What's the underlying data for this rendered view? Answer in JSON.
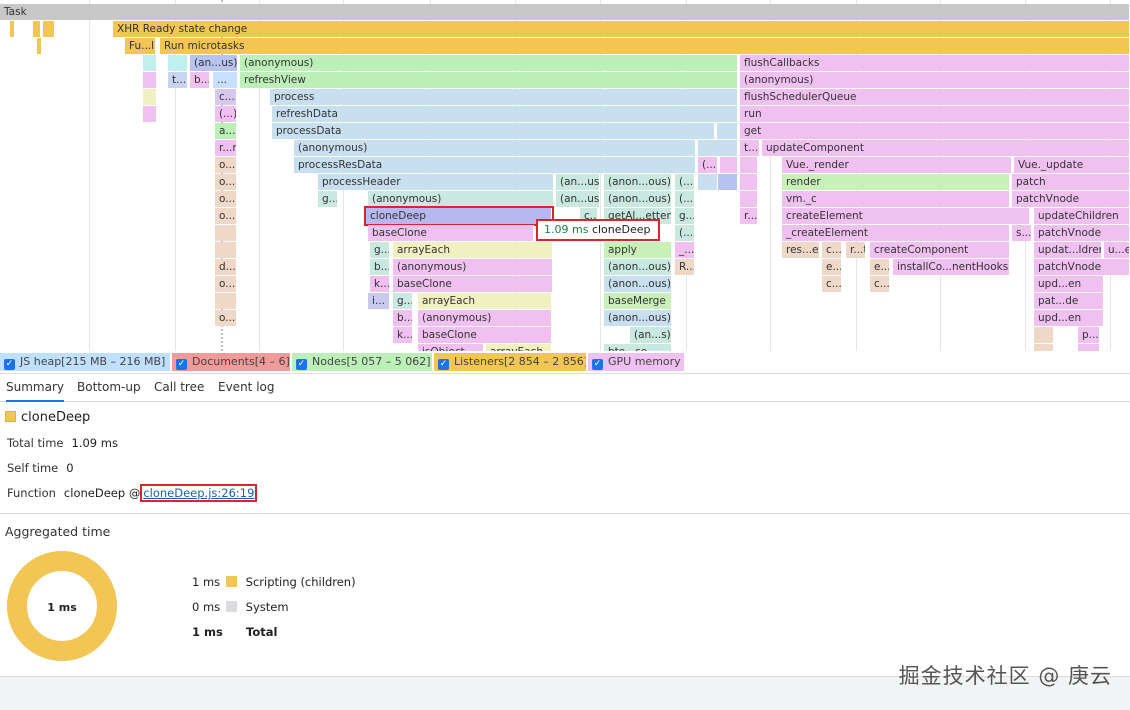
{
  "flame": {
    "vlines": [
      89,
      175,
      259,
      343,
      430,
      515,
      600,
      686,
      770,
      856,
      940,
      1025,
      1110
    ],
    "blocks": [
      {
        "l": 0,
        "t": 4,
        "w": 1130,
        "c": "#c8c8c8",
        "s": "Task"
      },
      {
        "l": 10,
        "t": 21,
        "w": 3,
        "c": "#f1c654",
        "s": ""
      },
      {
        "l": 33,
        "t": 21,
        "w": 8,
        "c": "#f1c654",
        "s": ""
      },
      {
        "l": 43,
        "t": 21,
        "w": 12,
        "c": "#f1c654",
        "s": ""
      },
      {
        "l": 113,
        "t": 21,
        "w": 1017,
        "c": "#f1c654",
        "s": "XHR Ready state change"
      },
      {
        "l": 37,
        "t": 38,
        "w": 4,
        "c": "#f1c654",
        "s": ""
      },
      {
        "l": 125,
        "t": 38,
        "w": 31,
        "c": "#f1c654",
        "s": "Fu...l"
      },
      {
        "l": 160,
        "t": 38,
        "w": 970,
        "c": "#f1c654",
        "s": "Run microtasks"
      },
      {
        "l": 143,
        "t": 55,
        "w": 14,
        "c": "#bff0ee",
        "s": ""
      },
      {
        "l": 168,
        "t": 55,
        "w": 20,
        "c": "#bff0ee",
        "s": ""
      },
      {
        "l": 190,
        "t": 55,
        "w": 48,
        "c": "#b8c4f0",
        "s": "(an...us)"
      },
      {
        "l": 240,
        "t": 55,
        "w": 498,
        "c": "#bdf0b8",
        "s": "(anonymous)"
      },
      {
        "l": 740,
        "t": 55,
        "w": 390,
        "c": "#f0c0f0",
        "s": "flushCallbacks"
      },
      {
        "l": 143,
        "t": 72,
        "w": 14,
        "c": "#f0c0f0",
        "s": ""
      },
      {
        "l": 168,
        "t": 72,
        "w": 20,
        "c": "#c8d4f0",
        "s": "t..."
      },
      {
        "l": 190,
        "t": 72,
        "w": 20,
        "c": "#f0c0f0",
        "s": "b..."
      },
      {
        "l": 213,
        "t": 72,
        "w": 25,
        "c": "#c8e0ff",
        "s": "..."
      },
      {
        "l": 240,
        "t": 72,
        "w": 498,
        "c": "#bdf0b8",
        "s": "refreshView"
      },
      {
        "l": 740,
        "t": 72,
        "w": 390,
        "c": "#f0c0f0",
        "s": "(anonymous)"
      },
      {
        "l": 143,
        "t": 89,
        "w": 14,
        "c": "#f0f0c0",
        "s": ""
      },
      {
        "l": 215,
        "t": 89,
        "w": 22,
        "c": "#d8c8f0",
        "s": "c..."
      },
      {
        "l": 270,
        "t": 89,
        "w": 468,
        "c": "#c8dff0",
        "s": "process"
      },
      {
        "l": 740,
        "t": 89,
        "w": 390,
        "c": "#f0c0f0",
        "s": "flushSchedulerQueue"
      },
      {
        "l": 143,
        "t": 106,
        "w": 14,
        "c": "#f0c0f0",
        "s": ""
      },
      {
        "l": 215,
        "t": 106,
        "w": 22,
        "c": "#f0c0f0",
        "s": "(...)"
      },
      {
        "l": 272,
        "t": 106,
        "w": 466,
        "c": "#c8dff0",
        "s": "refreshData"
      },
      {
        "l": 740,
        "t": 106,
        "w": 390,
        "c": "#f0c0f0",
        "s": "run"
      },
      {
        "l": 215,
        "t": 123,
        "w": 22,
        "c": "#bdf0b8",
        "s": "a..."
      },
      {
        "l": 272,
        "t": 123,
        "w": 443,
        "c": "#c8dff0",
        "s": "processData"
      },
      {
        "l": 717,
        "t": 123,
        "w": 21,
        "c": "#c8dff0",
        "s": ""
      },
      {
        "l": 740,
        "t": 123,
        "w": 390,
        "c": "#f0c0f0",
        "s": "get"
      },
      {
        "l": 215,
        "t": 140,
        "w": 22,
        "c": "#f0c0f0",
        "s": "r...r"
      },
      {
        "l": 294,
        "t": 140,
        "w": 402,
        "c": "#c8dff0",
        "s": "(anonymous)"
      },
      {
        "l": 698,
        "t": 140,
        "w": 40,
        "c": "#c8dff0",
        "s": ""
      },
      {
        "l": 740,
        "t": 140,
        "w": 20,
        "c": "#f0c0f0",
        "s": "t..."
      },
      {
        "l": 762,
        "t": 140,
        "w": 368,
        "c": "#f0c0f0",
        "s": "updateComponent"
      },
      {
        "l": 215,
        "t": 157,
        "w": 22,
        "c": "#f0d8c8",
        "s": "o..."
      },
      {
        "l": 294,
        "t": 157,
        "w": 402,
        "c": "#c8dff0",
        "s": "processResData"
      },
      {
        "l": 698,
        "t": 157,
        "w": 20,
        "c": "#f0c0f0",
        "s": "(..."
      },
      {
        "l": 720,
        "t": 157,
        "w": 18,
        "c": "#f0c0f0",
        "s": ""
      },
      {
        "l": 740,
        "t": 157,
        "w": 18,
        "c": "#f0c0f0",
        "s": ""
      },
      {
        "l": 782,
        "t": 157,
        "w": 230,
        "c": "#f0c0f0",
        "s": "Vue._render"
      },
      {
        "l": 1014,
        "t": 157,
        "w": 116,
        "c": "#f0c0f0",
        "s": "Vue._update"
      },
      {
        "l": 215,
        "t": 174,
        "w": 22,
        "c": "#f0d8c8",
        "s": "o..."
      },
      {
        "l": 318,
        "t": 174,
        "w": 236,
        "c": "#c8dff0",
        "s": "processHeader"
      },
      {
        "l": 556,
        "t": 174,
        "w": 44,
        "c": "#c8e8e0",
        "s": "(an...us)"
      },
      {
        "l": 604,
        "t": 174,
        "w": 68,
        "c": "#c8e8e0",
        "s": "(anon...ous)"
      },
      {
        "l": 675,
        "t": 174,
        "w": 20,
        "c": "#c8e8e0",
        "s": "(...)"
      },
      {
        "l": 698,
        "t": 174,
        "w": 20,
        "c": "#c8dff0",
        "s": ""
      },
      {
        "l": 718,
        "t": 174,
        "w": 20,
        "c": "#b8c4f0",
        "s": ""
      },
      {
        "l": 740,
        "t": 174,
        "w": 18,
        "c": "#f0c0f0",
        "s": ""
      },
      {
        "l": 782,
        "t": 174,
        "w": 228,
        "c": "#c8f0b8",
        "s": "render"
      },
      {
        "l": 1012,
        "t": 174,
        "w": 118,
        "c": "#f0c0f0",
        "s": "patch"
      },
      {
        "l": 215,
        "t": 191,
        "w": 22,
        "c": "#f0d8c8",
        "s": "o..."
      },
      {
        "l": 318,
        "t": 191,
        "w": 20,
        "c": "#c8e8e0",
        "s": "g..."
      },
      {
        "l": 368,
        "t": 191,
        "w": 186,
        "c": "#c8e8e0",
        "s": "(anonymous)"
      },
      {
        "l": 556,
        "t": 191,
        "w": 44,
        "c": "#c8e8e0",
        "s": "(an...us)"
      },
      {
        "l": 604,
        "t": 191,
        "w": 68,
        "c": "#c8e8e0",
        "s": "(anon...ous)"
      },
      {
        "l": 675,
        "t": 191,
        "w": 20,
        "c": "#c8e8e0",
        "s": "(...)"
      },
      {
        "l": 740,
        "t": 191,
        "w": 18,
        "c": "#f0c0f0",
        "s": ""
      },
      {
        "l": 782,
        "t": 191,
        "w": 228,
        "c": "#f0c0f0",
        "s": "vm._c"
      },
      {
        "l": 1012,
        "t": 191,
        "w": 118,
        "c": "#f0c0f0",
        "s": "patchVnode"
      },
      {
        "l": 215,
        "t": 208,
        "w": 22,
        "c": "#f0d8c8",
        "s": "o..."
      },
      {
        "l": 366,
        "t": 208,
        "w": 186,
        "c": "#b8b8f0",
        "s": "cloneDeep",
        "sel": true
      },
      {
        "l": 580,
        "t": 208,
        "w": 18,
        "c": "#c8e8e0",
        "s": "c..."
      },
      {
        "l": 604,
        "t": 208,
        "w": 68,
        "c": "#c8e8e0",
        "s": "getAl...etter"
      },
      {
        "l": 675,
        "t": 208,
        "w": 20,
        "c": "#c8e8e0",
        "s": "g..."
      },
      {
        "l": 740,
        "t": 208,
        "w": 18,
        "c": "#f0c0f0",
        "s": "r..."
      },
      {
        "l": 782,
        "t": 208,
        "w": 248,
        "c": "#f0c0f0",
        "s": "createElement"
      },
      {
        "l": 1034,
        "t": 208,
        "w": 96,
        "c": "#f0c0f0",
        "s": "updateChildren"
      },
      {
        "l": 215,
        "t": 225,
        "w": 22,
        "c": "#f0d8c8",
        "s": ""
      },
      {
        "l": 368,
        "t": 225,
        "w": 166,
        "c": "#f0c0f0",
        "s": "baseClone"
      },
      {
        "l": 675,
        "t": 225,
        "w": 20,
        "c": "#c8e8e0",
        "s": "(...)"
      },
      {
        "l": 782,
        "t": 225,
        "w": 228,
        "c": "#f0c0f0",
        "s": "_createElement"
      },
      {
        "l": 1012,
        "t": 225,
        "w": 20,
        "c": "#f0c0f0",
        "s": "s..."
      },
      {
        "l": 1034,
        "t": 225,
        "w": 96,
        "c": "#f0c0f0",
        "s": "patchVnode"
      },
      {
        "l": 215,
        "t": 242,
        "w": 22,
        "c": "#f0d8c8",
        "s": ""
      },
      {
        "l": 370,
        "t": 242,
        "w": 20,
        "c": "#c8e8e0",
        "s": "g..."
      },
      {
        "l": 393,
        "t": 242,
        "w": 160,
        "c": "#f0f0c0",
        "s": "arrayEach"
      },
      {
        "l": 604,
        "t": 242,
        "w": 68,
        "c": "#c8f0b8",
        "s": "apply"
      },
      {
        "l": 675,
        "t": 242,
        "w": 20,
        "c": "#f0c0f0",
        "s": "_..."
      },
      {
        "l": 782,
        "t": 242,
        "w": 38,
        "c": "#f0d8c8",
        "s": "res...et"
      },
      {
        "l": 822,
        "t": 242,
        "w": 20,
        "c": "#f0d8c8",
        "s": "c..."
      },
      {
        "l": 846,
        "t": 242,
        "w": 20,
        "c": "#f0d8c8",
        "s": "r...t"
      },
      {
        "l": 870,
        "t": 242,
        "w": 140,
        "c": "#f0c0f0",
        "s": "createComponent"
      },
      {
        "l": 1034,
        "t": 242,
        "w": 68,
        "c": "#f0c0f0",
        "s": "updat...ldren"
      },
      {
        "l": 1104,
        "t": 242,
        "w": 26,
        "c": "#f0c0f0",
        "s": "u...e"
      },
      {
        "l": 215,
        "t": 259,
        "w": 22,
        "c": "#f0d8c8",
        "s": "d..."
      },
      {
        "l": 370,
        "t": 259,
        "w": 20,
        "c": "#c8e8e0",
        "s": "b..."
      },
      {
        "l": 393,
        "t": 259,
        "w": 160,
        "c": "#f0c0f0",
        "s": "(anonymous)"
      },
      {
        "l": 604,
        "t": 259,
        "w": 68,
        "c": "#c8e8e0",
        "s": "(anon...ous)"
      },
      {
        "l": 675,
        "t": 259,
        "w": 20,
        "c": "#f0d8c8",
        "s": "R..."
      },
      {
        "l": 822,
        "t": 259,
        "w": 20,
        "c": "#f0d8c8",
        "s": "e..."
      },
      {
        "l": 870,
        "t": 259,
        "w": 20,
        "c": "#f0d8c8",
        "s": "e..."
      },
      {
        "l": 893,
        "t": 259,
        "w": 117,
        "c": "#f0c0f0",
        "s": "installCo...nentHooks"
      },
      {
        "l": 1034,
        "t": 259,
        "w": 96,
        "c": "#f0c0f0",
        "s": "patchVnode"
      },
      {
        "l": 215,
        "t": 276,
        "w": 22,
        "c": "#f0d8c8",
        "s": "o..."
      },
      {
        "l": 370,
        "t": 276,
        "w": 20,
        "c": "#f0c0f0",
        "s": "k..."
      },
      {
        "l": 393,
        "t": 276,
        "w": 160,
        "c": "#f0c0f0",
        "s": "baseClone"
      },
      {
        "l": 604,
        "t": 276,
        "w": 68,
        "c": "#c8dff0",
        "s": "(anon...ous)"
      },
      {
        "l": 822,
        "t": 276,
        "w": 20,
        "c": "#f0d8c8",
        "s": "c..."
      },
      {
        "l": 870,
        "t": 276,
        "w": 20,
        "c": "#f0d8c8",
        "s": "c..."
      },
      {
        "l": 1034,
        "t": 276,
        "w": 70,
        "c": "#f0c0f0",
        "s": "upd...en"
      },
      {
        "l": 215,
        "t": 293,
        "w": 22,
        "c": "#f0d8c8",
        "s": ""
      },
      {
        "l": 368,
        "t": 293,
        "w": 22,
        "c": "#c8c8f0",
        "s": "i..."
      },
      {
        "l": 393,
        "t": 293,
        "w": 20,
        "c": "#c8e8e0",
        "s": "g..."
      },
      {
        "l": 418,
        "t": 293,
        "w": 134,
        "c": "#f0f0c0",
        "s": "arrayEach"
      },
      {
        "l": 604,
        "t": 293,
        "w": 68,
        "c": "#c8f0b8",
        "s": "baseMerge"
      },
      {
        "l": 1034,
        "t": 293,
        "w": 70,
        "c": "#f0c0f0",
        "s": "pat...de"
      },
      {
        "l": 215,
        "t": 310,
        "w": 22,
        "c": "#f0d8c8",
        "s": "o..."
      },
      {
        "l": 393,
        "t": 310,
        "w": 20,
        "c": "#f0c0f0",
        "s": "b..."
      },
      {
        "l": 418,
        "t": 310,
        "w": 134,
        "c": "#f0c0f0",
        "s": "(anonymous)"
      },
      {
        "l": 604,
        "t": 310,
        "w": 68,
        "c": "#c8dff0",
        "s": "(anon...ous)"
      },
      {
        "l": 1034,
        "t": 310,
        "w": 70,
        "c": "#f0c0f0",
        "s": "upd...en"
      },
      {
        "l": 393,
        "t": 327,
        "w": 20,
        "c": "#f0c0f0",
        "s": "k..."
      },
      {
        "l": 418,
        "t": 327,
        "w": 134,
        "c": "#f0c0f0",
        "s": "baseClone"
      },
      {
        "l": 630,
        "t": 327,
        "w": 42,
        "c": "#c8e8e0",
        "s": "(an...s)"
      },
      {
        "l": 1034,
        "t": 327,
        "w": 20,
        "c": "#f0d8c8",
        "s": ""
      },
      {
        "l": 1078,
        "t": 327,
        "w": 22,
        "c": "#f0c0f0",
        "s": "p..."
      },
      {
        "l": 418,
        "t": 344,
        "w": 66,
        "c": "#f0c0f0",
        "s": "isObject"
      },
      {
        "l": 486,
        "t": 344,
        "w": 66,
        "c": "#f0f0c0",
        "s": "arrayEach"
      },
      {
        "l": 604,
        "t": 344,
        "w": 68,
        "c": "#c8e8e0",
        "s": "bte...se"
      },
      {
        "l": 1034,
        "t": 344,
        "w": 20,
        "c": "#f0d8c8",
        "s": ""
      },
      {
        "l": 1078,
        "t": 344,
        "w": 22,
        "c": "#f0c0f0",
        "s": ""
      }
    ]
  },
  "tooltip": {
    "time": "1.09 ms",
    "name": "cloneDeep"
  },
  "tracks": [
    {
      "label": "JS heap[215 MB – 216 MB]",
      "color": "#bfe0ff",
      "l": 0,
      "w": 170
    },
    {
      "label": "Documents[4 – 6]",
      "color": "#f09a9a",
      "l": 172,
      "w": 118
    },
    {
      "label": "Nodes[5 057 – 5 062]",
      "color": "#bdf0b8",
      "l": 292,
      "w": 140
    },
    {
      "label": "Listeners[2 854 – 2 856]",
      "color": "#f1c654",
      "l": 434,
      "w": 152
    },
    {
      "label": "GPU memory",
      "color": "#f0c0f0",
      "l": 588,
      "w": 96
    }
  ],
  "tabs": [
    {
      "label": "Summary",
      "l": 6,
      "active": true
    },
    {
      "label": "Bottom-up",
      "l": 77
    },
    {
      "label": "Call tree",
      "l": 154
    },
    {
      "label": "Event log",
      "l": 218
    }
  ],
  "summary": {
    "title": "cloneDeep",
    "total_label": "Total time",
    "total_value": "1.09 ms",
    "self_label": "Self time",
    "self_value": "0",
    "function_label": "Function",
    "function_name": "cloneDeep",
    "function_at": "@",
    "function_link": "cloneDeep.js:26:19"
  },
  "aggregated": {
    "title": "Aggregated time",
    "center_label": "1 ms",
    "rows": [
      {
        "value": "1 ms",
        "label": "Scripting (children)",
        "color": "#f1c654"
      },
      {
        "value": "0 ms",
        "label": "System",
        "color": "#dadce0"
      }
    ],
    "total_value": "1 ms",
    "total_label": "Total"
  },
  "watermark": "掘金技术社区 @ 庚云"
}
